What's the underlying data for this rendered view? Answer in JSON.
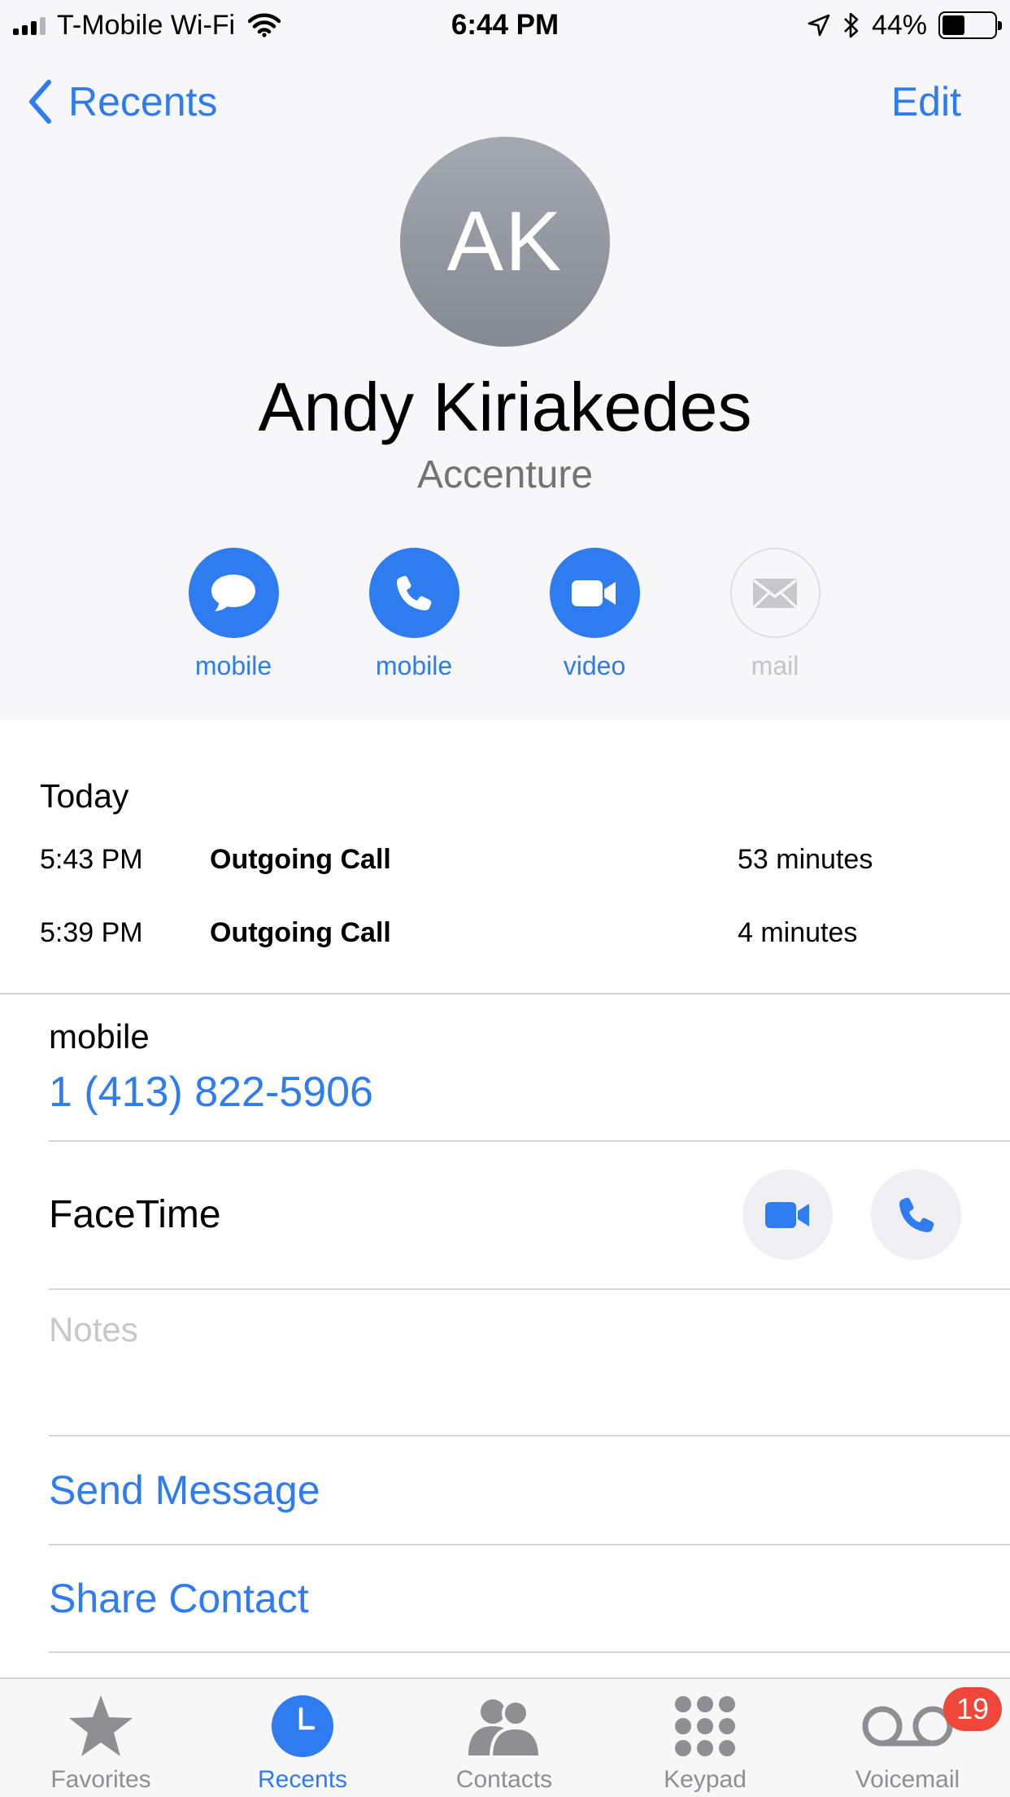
{
  "status_bar": {
    "carrier": "T-Mobile Wi-Fi",
    "time": "6:44 PM",
    "battery_percent": "44%",
    "battery_level": 0.44
  },
  "nav": {
    "back_label": "Recents",
    "edit_label": "Edit"
  },
  "contact": {
    "initials": "AK",
    "name": "Andy Kiriakedes",
    "company": "Accenture"
  },
  "actions": [
    {
      "label": "mobile",
      "icon": "message-bubble-icon",
      "enabled": true
    },
    {
      "label": "mobile",
      "icon": "phone-icon",
      "enabled": true
    },
    {
      "label": "video",
      "icon": "video-camera-icon",
      "enabled": true
    },
    {
      "label": "mail",
      "icon": "envelope-icon",
      "enabled": false
    }
  ],
  "history": {
    "day_label": "Today",
    "calls": [
      {
        "time": "5:43 PM",
        "type": "Outgoing Call",
        "duration": "53 minutes"
      },
      {
        "time": "5:39 PM",
        "type": "Outgoing Call",
        "duration": "4 minutes"
      }
    ]
  },
  "phone": {
    "label": "mobile",
    "number": "1 (413) 822-5906"
  },
  "facetime": {
    "label": "FaceTime"
  },
  "notes": {
    "placeholder": "Notes"
  },
  "links": {
    "send_message": "Send Message",
    "share_contact": "Share Contact"
  },
  "tabbar": {
    "tabs": [
      {
        "label": "Favorites",
        "icon": "star-icon",
        "active": false
      },
      {
        "label": "Recents",
        "icon": "clock-icon",
        "active": true
      },
      {
        "label": "Contacts",
        "icon": "contacts-icon",
        "active": false
      },
      {
        "label": "Keypad",
        "icon": "keypad-icon",
        "active": false
      },
      {
        "label": "Voicemail",
        "icon": "voicemail-icon",
        "active": false
      }
    ],
    "voicemail_badge": "19"
  },
  "colors": {
    "accent": "#2f7bf0",
    "header_bg": "#f7f7fa",
    "badge": "#f0473b"
  }
}
